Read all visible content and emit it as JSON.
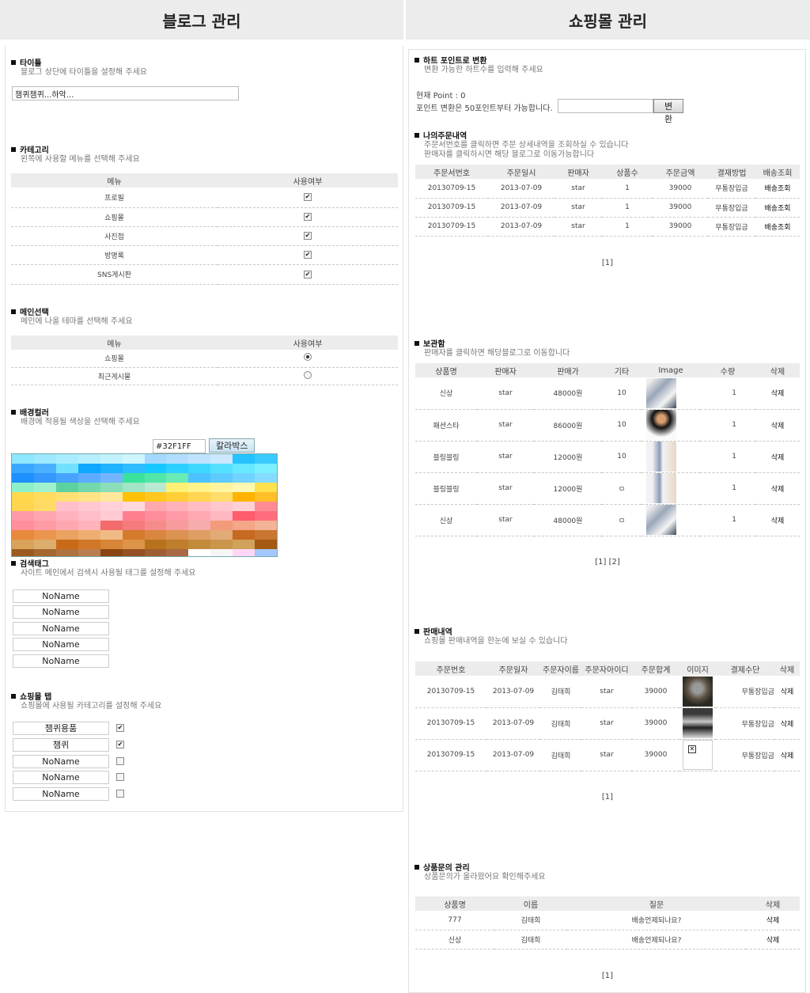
{
  "headers": {
    "left": "블로그 관리",
    "right": "쇼핑몰 관리"
  },
  "blog": {
    "title": {
      "heading": "타이틀",
      "desc": "블로그 상단에 타이틀을 설정해 주세요",
      "value": "챔퀴챔퀴...하악..."
    },
    "category": {
      "heading": "카테고리",
      "desc": "왼쪽에 사용할 메뉴를 선택해 주세요",
      "col_menu": "메뉴",
      "col_use": "사용여부",
      "rows": [
        "프로필",
        "쇼핑몰",
        "사진첩",
        "방명록",
        "SNS게시판"
      ]
    },
    "main": {
      "heading": "메인선택",
      "desc": "메인에 나올 테마를 선택해 주세요",
      "col_menu": "메뉴",
      "col_use": "사용여부",
      "rows": [
        "쇼핑몰",
        "최근게시물"
      ]
    },
    "bg": {
      "heading": "배경컬러",
      "desc": "배경에 적용될 색상을 선택해 주세요",
      "value": "#32F1FF",
      "button": "칼라박스"
    },
    "tags": {
      "heading": "검색태그",
      "desc": "사이트 메인에서 검색시 사용될 태그를 설정해 주세요",
      "items": [
        "NoName",
        "NoName",
        "NoName",
        "NoName",
        "NoName"
      ]
    },
    "shoptab": {
      "heading": "쇼핑몰 탭",
      "desc": "쇼핑몰에 사용될 카테고리를 설정해 주세요",
      "items": [
        "챔퀴용품",
        "챔퀴",
        "NoName",
        "NoName",
        "NoName"
      ]
    }
  },
  "shop": {
    "heart": {
      "heading": "하트 포인트로 변환",
      "desc": "변환 가능한 하트수를 입력해 주세요",
      "current": "현재 Point : 0",
      "note": "포인트 변환은 50포인트부터 가능합니다.",
      "button": "변환"
    },
    "orders": {
      "heading": "나의주문내역",
      "desc1": "주문서번호를 클릭하면 주문 상세내역을 조회하실 수 있습니다",
      "desc2": "판매자를 클릭하시면 해당 블로그로 이동가능합니다",
      "cols": [
        "주문서번호",
        "주문일시",
        "판매자",
        "상품수",
        "주문금액",
        "결재방법",
        "배송조회"
      ],
      "rows": [
        [
          "20130709-15",
          "2013-07-09",
          "star",
          "1",
          "39000",
          "무통장입금",
          "배송조회"
        ],
        [
          "20130709-15",
          "2013-07-09",
          "star",
          "1",
          "39000",
          "무통장입금",
          "배송조회"
        ],
        [
          "20130709-15",
          "2013-07-09",
          "star",
          "1",
          "39000",
          "무통장입금",
          "배송조회"
        ]
      ],
      "pager": "[1]"
    },
    "wish": {
      "heading": "보관함",
      "desc": "판매자를 클릭하면 해당블로그로 이동합니다",
      "cols": [
        "상품명",
        "판매자",
        "판매가",
        "기타",
        "Image",
        "수량",
        "삭제"
      ],
      "rows": [
        [
          "신상",
          "star",
          "48000원",
          "10",
          "1",
          "삭제"
        ],
        [
          "패션스타",
          "star",
          "86000원",
          "10",
          "1",
          "삭제"
        ],
        [
          "블링블링",
          "star",
          "12000원",
          "10",
          "1",
          "삭제"
        ],
        [
          "블링블링",
          "star",
          "12000원",
          "ㅁ",
          "1",
          "삭제"
        ],
        [
          "신상",
          "star",
          "48000원",
          "ㅁ",
          "1",
          "삭제"
        ]
      ],
      "pager": "[1] [2]"
    },
    "sales": {
      "heading": "판매내역",
      "desc": "쇼핑몰 판매내역을 한눈에 보실 수 있습니다",
      "cols": [
        "주문번호",
        "주문일자",
        "주문자이름",
        "주문자아이디",
        "주문합계",
        "이미지",
        "결제수단",
        "삭제"
      ],
      "rows": [
        [
          "20130709-15",
          "2013-07-09",
          "김태희",
          "star",
          "39000",
          "무통장입금",
          "삭제"
        ],
        [
          "20130709-15",
          "2013-07-09",
          "김태희",
          "star",
          "39000",
          "무통장입금",
          "삭제"
        ],
        [
          "20130709-15",
          "2013-07-09",
          "김태희",
          "star",
          "39000",
          "무통장입금",
          "삭제"
        ]
      ],
      "pager": "[1]"
    },
    "qna": {
      "heading": "상품문의 관리",
      "desc": "상품문의가 올라왔어요 확인해주세요",
      "cols": [
        "상품명",
        "이름",
        "질문",
        "삭제"
      ],
      "rows": [
        [
          "777",
          "김태희",
          "배송언제되나요?",
          "삭제"
        ],
        [
          "신상",
          "김태희",
          "배송언제되나요?",
          "삭제"
        ]
      ],
      "pager": "[1]"
    }
  }
}
